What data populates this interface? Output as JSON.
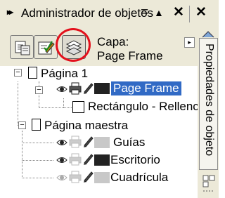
{
  "docker": {
    "title": "Administrador de objetos",
    "title_controls": [
      "=",
      "▲",
      "✕"
    ],
    "title_controls_right": "✕"
  },
  "toolbar": {
    "buttons": [
      {
        "name": "show-object-properties",
        "icon": "object-properties-icon"
      },
      {
        "name": "edit-across-layers",
        "icon": "edit-layers-icon"
      },
      {
        "name": "layer-manager-view",
        "icon": "layer-manager-icon",
        "highlighted": true
      }
    ],
    "capa_label": "Capa:",
    "capa_value": "Page Frame",
    "menu_button": "▸"
  },
  "tree": {
    "page1": {
      "label": "Página 1",
      "layer": {
        "label": "Page Frame",
        "color": "#222222",
        "selected": true
      },
      "object": "Rectángulo - Rellenc"
    },
    "master": {
      "label": "Página maestra",
      "layers": [
        {
          "label": "Guías",
          "color": "#c8c8c8"
        },
        {
          "label": "Escritorio",
          "color": "#222222"
        },
        {
          "label": "Cuadrícula",
          "color": "#c8c8c8"
        }
      ]
    }
  },
  "side_tab": {
    "label": "Propiedades de objeto"
  },
  "colors": {
    "selection": "#316ac5",
    "highlight_circle": "#e3101c",
    "chrome": "#ece9d8"
  }
}
